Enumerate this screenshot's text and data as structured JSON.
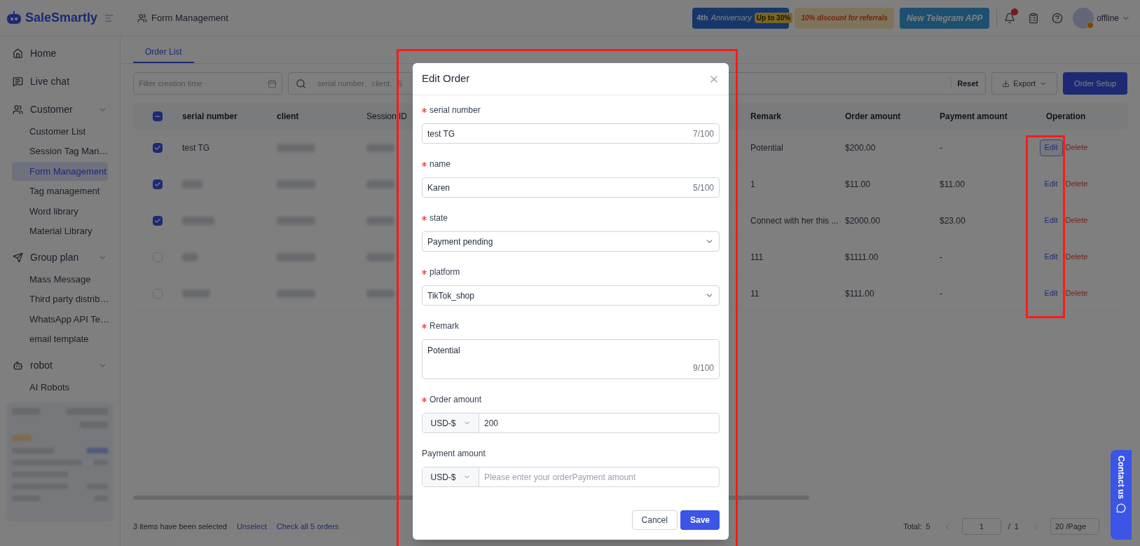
{
  "brand": "SaleSmartly",
  "header": {
    "title": "Form Management",
    "banners": [
      {
        "kind": "anniversary",
        "text": "Anniversary",
        "tag": "Up to 30%",
        "prefix": "4th"
      },
      {
        "kind": "referral",
        "text": "10% discount for referrals"
      },
      {
        "kind": "telegram",
        "text": "New Telegram APP"
      }
    ],
    "notification_badge": true,
    "status": "offline"
  },
  "sidebar": {
    "items": [
      {
        "label": "Home",
        "selected": false
      },
      {
        "label": "Live chat",
        "selected": false
      },
      {
        "label": "Customer",
        "expanded": true,
        "children": [
          {
            "label": "Customer List",
            "selected": false
          },
          {
            "label": "Session Tag Man…",
            "selected": false
          },
          {
            "label": "Form Management",
            "selected": true
          },
          {
            "label": "Tag management",
            "selected": false
          },
          {
            "label": "Word library",
            "selected": false
          },
          {
            "label": "Material Library",
            "selected": false
          }
        ]
      },
      {
        "label": "Group plan",
        "expanded": true,
        "children": [
          {
            "label": "Mass Message",
            "selected": false
          },
          {
            "label": "Third party distrib…",
            "selected": false
          },
          {
            "label": "WhatsApp API Te…",
            "selected": false
          },
          {
            "label": "email template",
            "selected": false
          }
        ]
      },
      {
        "label": "robot",
        "expanded": true,
        "children": [
          {
            "label": "AI Robots",
            "selected": false
          }
        ]
      }
    ]
  },
  "tabs": [
    {
      "label": "Order List",
      "selected": true
    }
  ],
  "toolbar": {
    "date_placeholder": "Filter creation time",
    "search_placeholder": "serial number、client、S",
    "reset": "Reset",
    "export": "Export",
    "setup": "Order Setup"
  },
  "table": {
    "select_all_partial": true,
    "columns": [
      "serial number",
      "client",
      "Session ID",
      "Remark",
      "Order amount",
      "Payment amount",
      "Operation"
    ],
    "rows": [
      {
        "checked": true,
        "serial_number": "test TG",
        "remark": "Potential",
        "order_amount": "$200.00",
        "payment_amount": "-",
        "edit": "Edit",
        "delete": "Delete",
        "focused": true
      },
      {
        "checked": true,
        "remark": "1",
        "order_amount": "$11.00",
        "payment_amount": "$11.00",
        "edit": "Edit",
        "delete": "Delete",
        "focused": false
      },
      {
        "checked": true,
        "remark": "Connect with her this ...",
        "order_amount": "$2000.00",
        "payment_amount": "$23.00",
        "edit": "Edit",
        "delete": "Delete",
        "focused": false
      },
      {
        "checked": false,
        "remark": "111",
        "order_amount": "$1111.00",
        "payment_amount": "-",
        "edit": "Edit",
        "delete": "Delete",
        "focused": false
      },
      {
        "checked": false,
        "remark": "11",
        "order_amount": "$111.00",
        "payment_amount": "-",
        "edit": "Edit",
        "delete": "Delete",
        "focused": false
      }
    ]
  },
  "footer": {
    "selected_text": "3 items have been selected",
    "unselect": "Unselect",
    "check_all": "Check all 5 orders",
    "total": "Total:  5",
    "page": "1",
    "pages": "/  1",
    "page_size": "20 /Page"
  },
  "contact": "Contact us",
  "dialog": {
    "title": "Edit Order",
    "fields": [
      {
        "kind": "text",
        "label": "serial number",
        "required": true,
        "value": "test TG",
        "counter": "7/100"
      },
      {
        "kind": "text",
        "label": "name",
        "required": true,
        "value": "Karen",
        "counter": "5/100"
      },
      {
        "kind": "select",
        "label": "state",
        "required": true,
        "value": "Payment pending"
      },
      {
        "kind": "select",
        "label": "platform",
        "required": true,
        "value": "TikTok_shop"
      },
      {
        "kind": "textarea",
        "label": "Remark",
        "required": true,
        "value": "Potential",
        "counter": "9/100"
      },
      {
        "kind": "currency",
        "label": "Order amount",
        "required": true,
        "currency": "USD-$",
        "value": "200"
      },
      {
        "kind": "currency",
        "label": "Payment amount",
        "required": false,
        "currency": "USD-$",
        "placeholder": "Please enter your orderPayment amount"
      }
    ],
    "cancel": "Cancel",
    "save": "Save"
  }
}
